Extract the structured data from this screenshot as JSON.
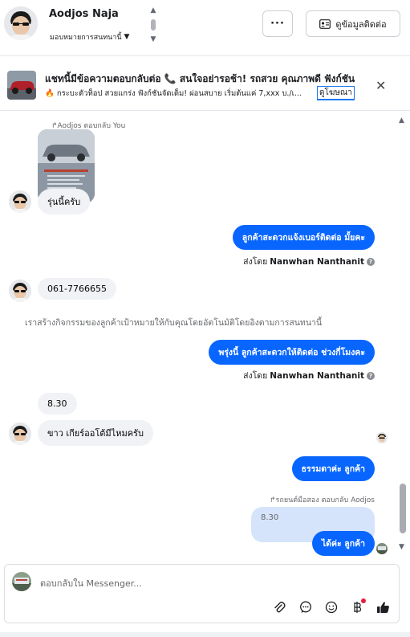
{
  "header": {
    "contact_name": "Aodjos Naja",
    "assign_label": "มอบหมายการสนทนานี้",
    "more_label": "···",
    "contact_button_label": "ดูข้อมูลติดต่อ"
  },
  "ad": {
    "title": "แชทนี้มีข้อความตอบกลับต่อ 📞 สนใจอย่ารอช้า! รถสวย คุณภาพดี ฟังก์ชัน",
    "subtitle": "🔥 กระบะตัวท็อป สวยแกร่ง ฟังก์ชันจัดเต็ม! ผ่อนสบาย เริ่มต้นแค่ 7,xxx บ./เ...",
    "link_label": "ดูโฆษณา"
  },
  "thread": {
    "reply_meta_1": "Aodjos ตอบกลับ You",
    "msg_model": "รุ่นนี้ครับ",
    "msg_ask_number": "ลูกค้าสะดวกแจ้งเบอร์ติดต่อ มั้ยคะ",
    "sent_by_prefix": "ส่งโดย",
    "sent_by_name": "Nanwhan Nanthanit",
    "msg_phone": "061-7766655",
    "system_note": "เราสร้างกิจกรรมของลูกค้าเป้าหมายให้กับคุณโดยอัตโนมัติโดยอิงตามการสนทนานี้",
    "msg_callback": "พรุ่งนี้ ลูกค้าสะดวกให้ติดต่อ ช่วงกี่โมงคะ",
    "msg_time": "8.30",
    "msg_gear": "ขาว เกียร์ออโต้มีไหมครับ",
    "msg_normal": "ธรรมดาค่ะ  ลูกค้า",
    "reply_meta_2": "รถยนต์มือสอง ตอบกลับ Aodjos",
    "quote_text": "8.30",
    "msg_ok": "ได้ค่ะ  ลูกค้า"
  },
  "composer": {
    "placeholder": "ตอบกลับใน Messenger..."
  },
  "icons": {
    "attach": "paperclip-icon",
    "saved_reply": "chat-bubble-icon",
    "emoji": "smiley-icon",
    "payment": "baht-icon",
    "like": "thumbs-up-icon"
  },
  "colors": {
    "outgoing_bubble": "#0866ff",
    "incoming_bubble": "#f0f2f5",
    "quote_bubble": "#d6e4fb",
    "link_underline": "#1877f2"
  }
}
